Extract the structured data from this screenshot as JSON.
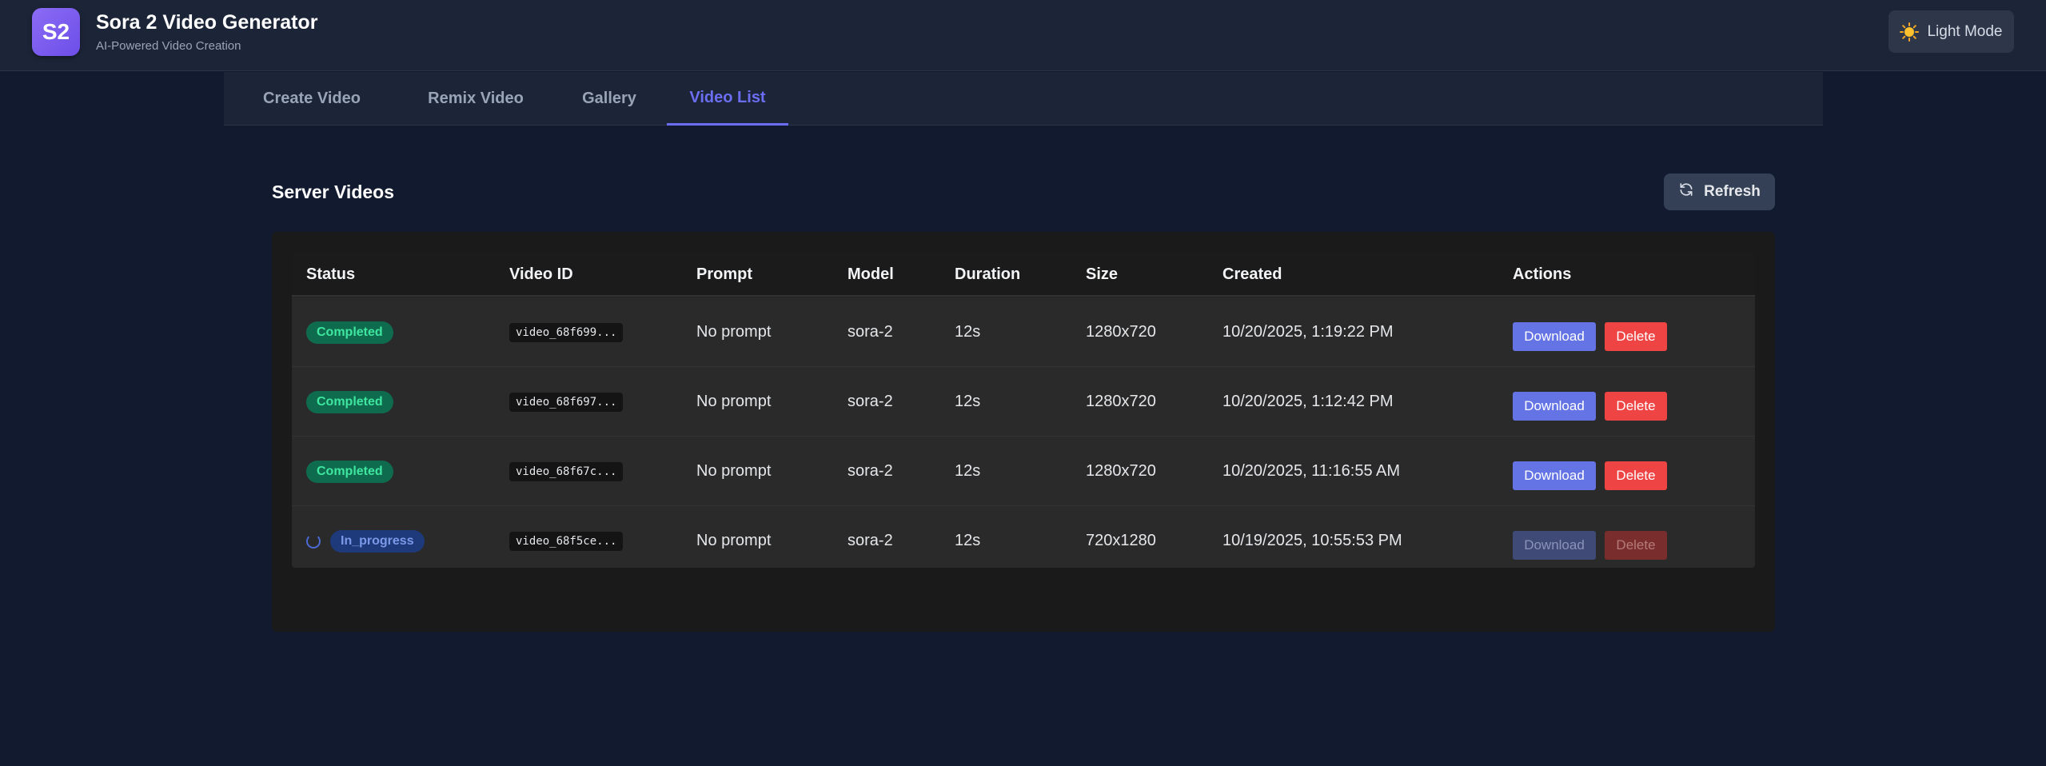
{
  "app": {
    "logo_text": "S2",
    "title": "Sora 2 Video Generator",
    "subtitle": "AI-Powered Video Creation",
    "theme_toggle_label": "Light Mode",
    "theme_icon": "sun-icon"
  },
  "tabs": [
    {
      "label": "Create Video",
      "active": false
    },
    {
      "label": "Remix Video",
      "active": false
    },
    {
      "label": "Gallery",
      "active": false
    },
    {
      "label": "Video List",
      "active": true
    }
  ],
  "section": {
    "title": "Server Videos",
    "refresh_label": "Refresh",
    "refresh_icon": "refresh-icon"
  },
  "table": {
    "headers": [
      "Status",
      "Video ID",
      "Prompt",
      "Model",
      "Duration",
      "Size",
      "Created",
      "Actions"
    ],
    "rows": [
      {
        "status": "Completed",
        "video_id": "video_68f699...",
        "prompt": "No prompt",
        "model": "sora-2",
        "duration": "12s",
        "size": "1280x720",
        "created": "10/20/2025, 1:19:22 PM",
        "download": "Download",
        "delete": "Delete",
        "disabled": false
      },
      {
        "status": "Completed",
        "video_id": "video_68f697...",
        "prompt": "No prompt",
        "model": "sora-2",
        "duration": "12s",
        "size": "1280x720",
        "created": "10/20/2025, 1:12:42 PM",
        "download": "Download",
        "delete": "Delete",
        "disabled": false
      },
      {
        "status": "Completed",
        "video_id": "video_68f67c...",
        "prompt": "No prompt",
        "model": "sora-2",
        "duration": "12s",
        "size": "1280x720",
        "created": "10/20/2025, 11:16:55 AM",
        "download": "Download",
        "delete": "Delete",
        "disabled": false
      },
      {
        "status": "In_progress",
        "video_id": "video_68f5ce...",
        "prompt": "No prompt",
        "model": "sora-2",
        "duration": "12s",
        "size": "720x1280",
        "created": "10/19/2025, 10:55:53 PM",
        "download": "Download",
        "delete": "Delete",
        "disabled": true
      }
    ]
  },
  "colors": {
    "accent": "#6b6ef0",
    "completed_badge": "#0f6b4e",
    "in_progress_badge": "#1f3a7a",
    "danger": "#ef4444",
    "primary_button": "#6474e5"
  }
}
